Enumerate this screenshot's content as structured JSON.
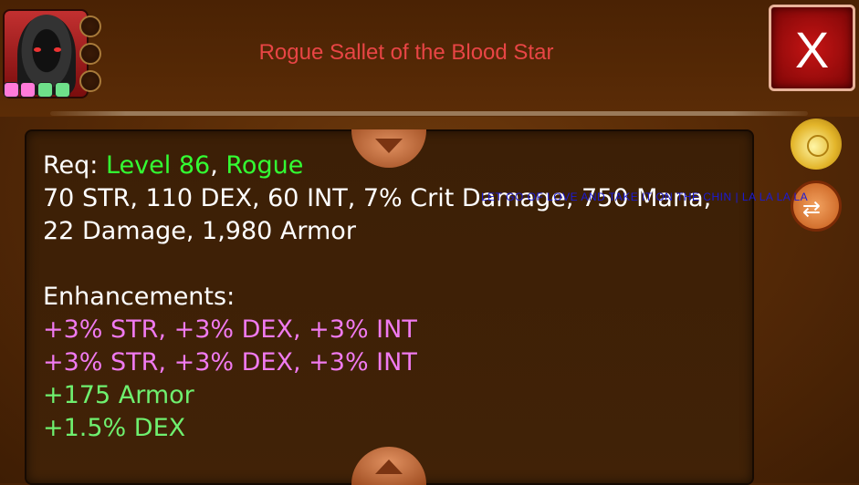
{
  "header": {
    "title": "Rogue Sallet of the Blood Star",
    "close_label": "X"
  },
  "portrait": {
    "gem_colors": [
      "#ff7ad9",
      "#ff7ad9",
      "#6ee08a",
      "#6ee08a"
    ]
  },
  "item": {
    "req_prefix": "Req: ",
    "req_level": "Level 86",
    "req_sep": ", ",
    "req_class": "Rogue",
    "stats_line1": "70 STR, 110 DEX, 60 INT, 7% Crit Damage, 750 Mana,",
    "stats_line2": "22 Damage, 1,980 Armor",
    "enh_header": "Enhancements:",
    "enhancements": [
      "+3% STR, +3% DEX, +3% INT",
      "+3% STR, +3% DEX, +3% INT",
      "+175 Armor",
      "+1.5% DEX"
    ]
  },
  "overlay_text": "LET GO OF LOVE AND TAKE IT ON THE CHIN  |  LA LA LA LA",
  "colors": {
    "title": "#e84545",
    "requirement_green": "#33ff33",
    "enhancement_pink": "#f07af0",
    "enhancement_green": "#6ff06f"
  },
  "icons": {
    "gold": "gold-bag-icon",
    "swap": "swap-arrow-icon",
    "scroll_up": "scroll-up-icon",
    "scroll_down": "scroll-down-icon"
  }
}
